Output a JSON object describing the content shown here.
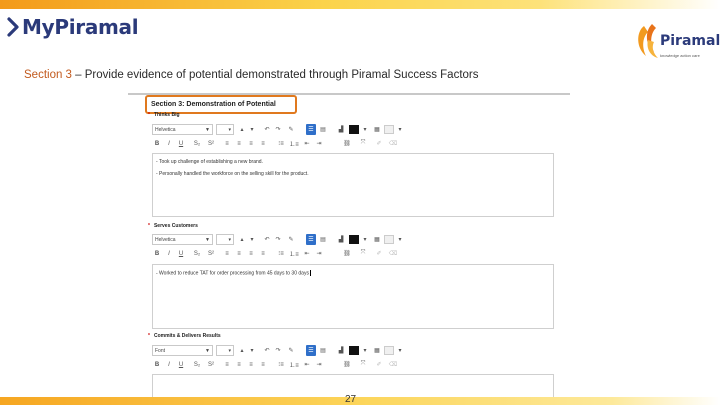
{
  "brand": {
    "name": "MyPiramal"
  },
  "corporate_logo": {
    "name": "Piramal",
    "tagline": "knowledge action care"
  },
  "heading": {
    "label": "Section 3",
    "text": " – Provide evidence of potential demonstrated through Piramal Success Factors"
  },
  "panel": {
    "section_title": "Section 3: Demonstration of Potential",
    "fields": [
      {
        "label": "Thinks Big",
        "font": "Helvetica",
        "size": "",
        "lines": [
          "- Took up challenge of establishing a new brand.",
          "- Personally handled the workforce on the selling skill for the product."
        ]
      },
      {
        "label": "Serves Customers",
        "font": "Helvetica",
        "size": "",
        "lines": [
          "- Worked to reduce TAT for order processing from 45 days to 30 days"
        ]
      },
      {
        "label": "Commits & Delivers Results",
        "font": "Font",
        "size": "",
        "lines": []
      }
    ]
  },
  "colors": {
    "accent_orange": "#e0791e",
    "brand_blue": "#2b3a7a",
    "toolbar_active": "#2f6fc9"
  },
  "page_number": "27"
}
